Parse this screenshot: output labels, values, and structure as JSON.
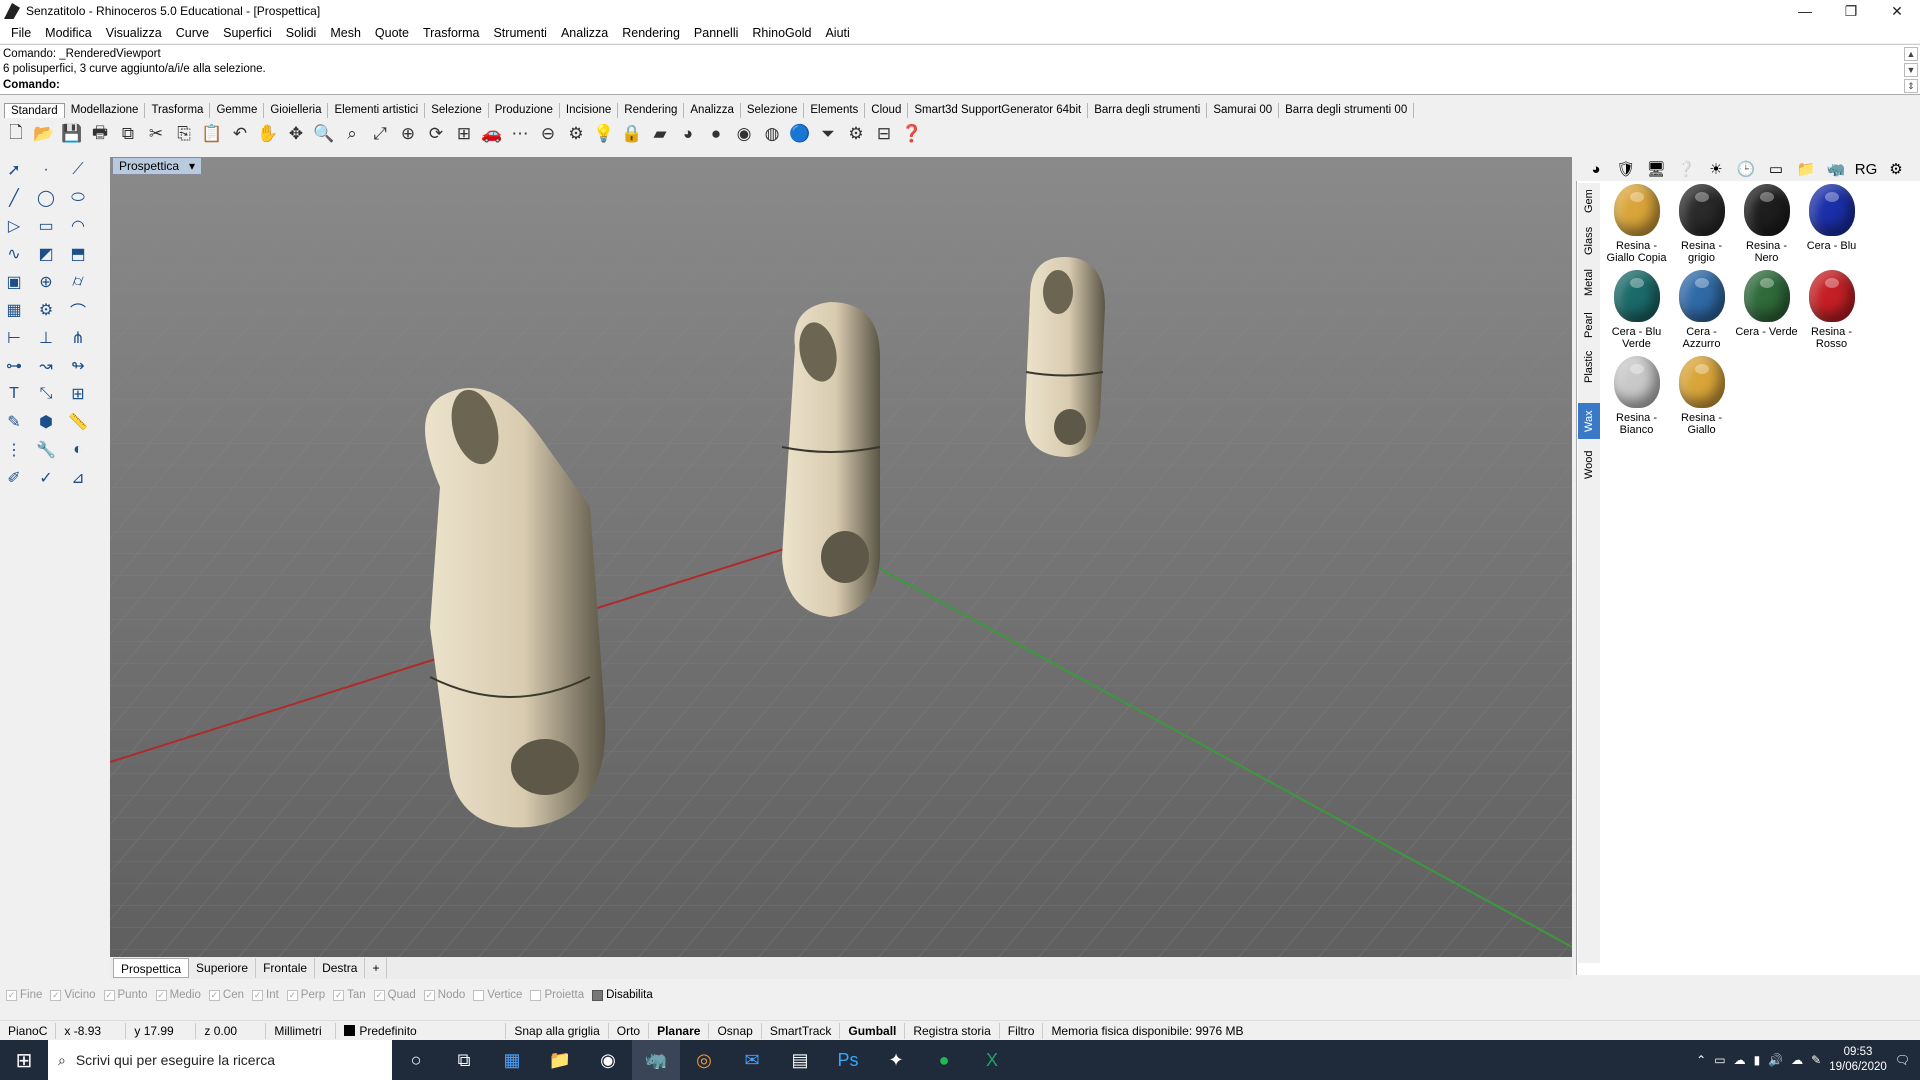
{
  "window": {
    "title": "Senzatitolo - Rhinoceros 5.0 Educational - [Prospettica]",
    "minimize": "—",
    "maximize": "❐",
    "close": "✕"
  },
  "menu": [
    "File",
    "Modifica",
    "Visualizza",
    "Curve",
    "Superfici",
    "Solidi",
    "Mesh",
    "Quote",
    "Trasforma",
    "Strumenti",
    "Analizza",
    "Rendering",
    "Pannelli",
    "RhinoGold",
    "Aiuti"
  ],
  "command": {
    "history1": "Comando: _RenderedViewport",
    "history2": "6 polisuperfici, 3 curve aggiunto/a/i/e alla selezione.",
    "prompt": "Comando:"
  },
  "toolbar_tabs": [
    "Standard",
    "Modellazione",
    "Trasforma",
    "Gemme",
    "Gioielleria",
    "Elementi artistici",
    "Selezione",
    "Produzione",
    "Incisione",
    "Rendering",
    "Analizza",
    "Selezione",
    "Elements",
    "Cloud",
    "Smart3d SupportGenerator 64bit",
    "Barra degli strumenti",
    "Samurai 00",
    "Barra degli strumenti 00"
  ],
  "viewport": {
    "label": "Prospettica",
    "tabs": [
      "Prospettica",
      "Superiore",
      "Frontale",
      "Destra"
    ],
    "add_tab": "+"
  },
  "panel": {
    "side_tabs": [
      "Gem",
      "Glass",
      "Metal",
      "Pearl",
      "Plastic",
      "Wax",
      "Wood"
    ],
    "active_side_tab": "Wax",
    "materials": [
      {
        "name": "Resina - Giallo Copia",
        "color": "#d9a53a"
      },
      {
        "name": "Resina - grigio",
        "color": "#2a2a2a"
      },
      {
        "name": "Resina - Nero",
        "color": "#1e1e1e"
      },
      {
        "name": "Cera - Blu",
        "color": "#1a2fa8"
      },
      {
        "name": "Cera - Blu Verde",
        "color": "#1b6a6a"
      },
      {
        "name": "Cera - Azzurro",
        "color": "#2f6aa6"
      },
      {
        "name": "Cera - Verde",
        "color": "#2e6a3a"
      },
      {
        "name": "Resina - Rosso",
        "color": "#c41f24"
      },
      {
        "name": "Resina - Bianco",
        "color": "#c9c9c9"
      },
      {
        "name": "Resina - Giallo",
        "color": "#d9a53a"
      }
    ]
  },
  "osnap": [
    {
      "label": "Fine"
    },
    {
      "label": "Vicino"
    },
    {
      "label": "Punto"
    },
    {
      "label": "Medio"
    },
    {
      "label": "Cen"
    },
    {
      "label": "Int"
    },
    {
      "label": "Perp"
    },
    {
      "label": "Tan"
    },
    {
      "label": "Quad"
    },
    {
      "label": "Nodo"
    },
    {
      "label": "Vertice"
    },
    {
      "label": "Proietta"
    },
    {
      "label": "Disabilita"
    }
  ],
  "status": {
    "cplane": "PianoC",
    "x": "x -8.93",
    "y": "y 17.99",
    "z": "z 0.00",
    "units": "Millimetri",
    "layer": "Predefinito",
    "snap": "Snap alla griglia",
    "ortho": "Orto",
    "planar": "Planare",
    "osnap": "Osnap",
    "smarttrack": "SmartTrack",
    "gumball": "Gumball",
    "history": "Registra storia",
    "filter": "Filtro",
    "memory": "Memoria fisica disponibile: 9976 MB"
  },
  "taskbar": {
    "search_placeholder": "Scrivi qui per eseguire la ricerca",
    "time": "09:53",
    "date": "19/06/2020"
  },
  "colors": {
    "viewport_bg": "#6f6f6f",
    "x_axis": "#b02a2a",
    "y_axis": "#3a9a3a",
    "part": "#d8cbb0"
  }
}
